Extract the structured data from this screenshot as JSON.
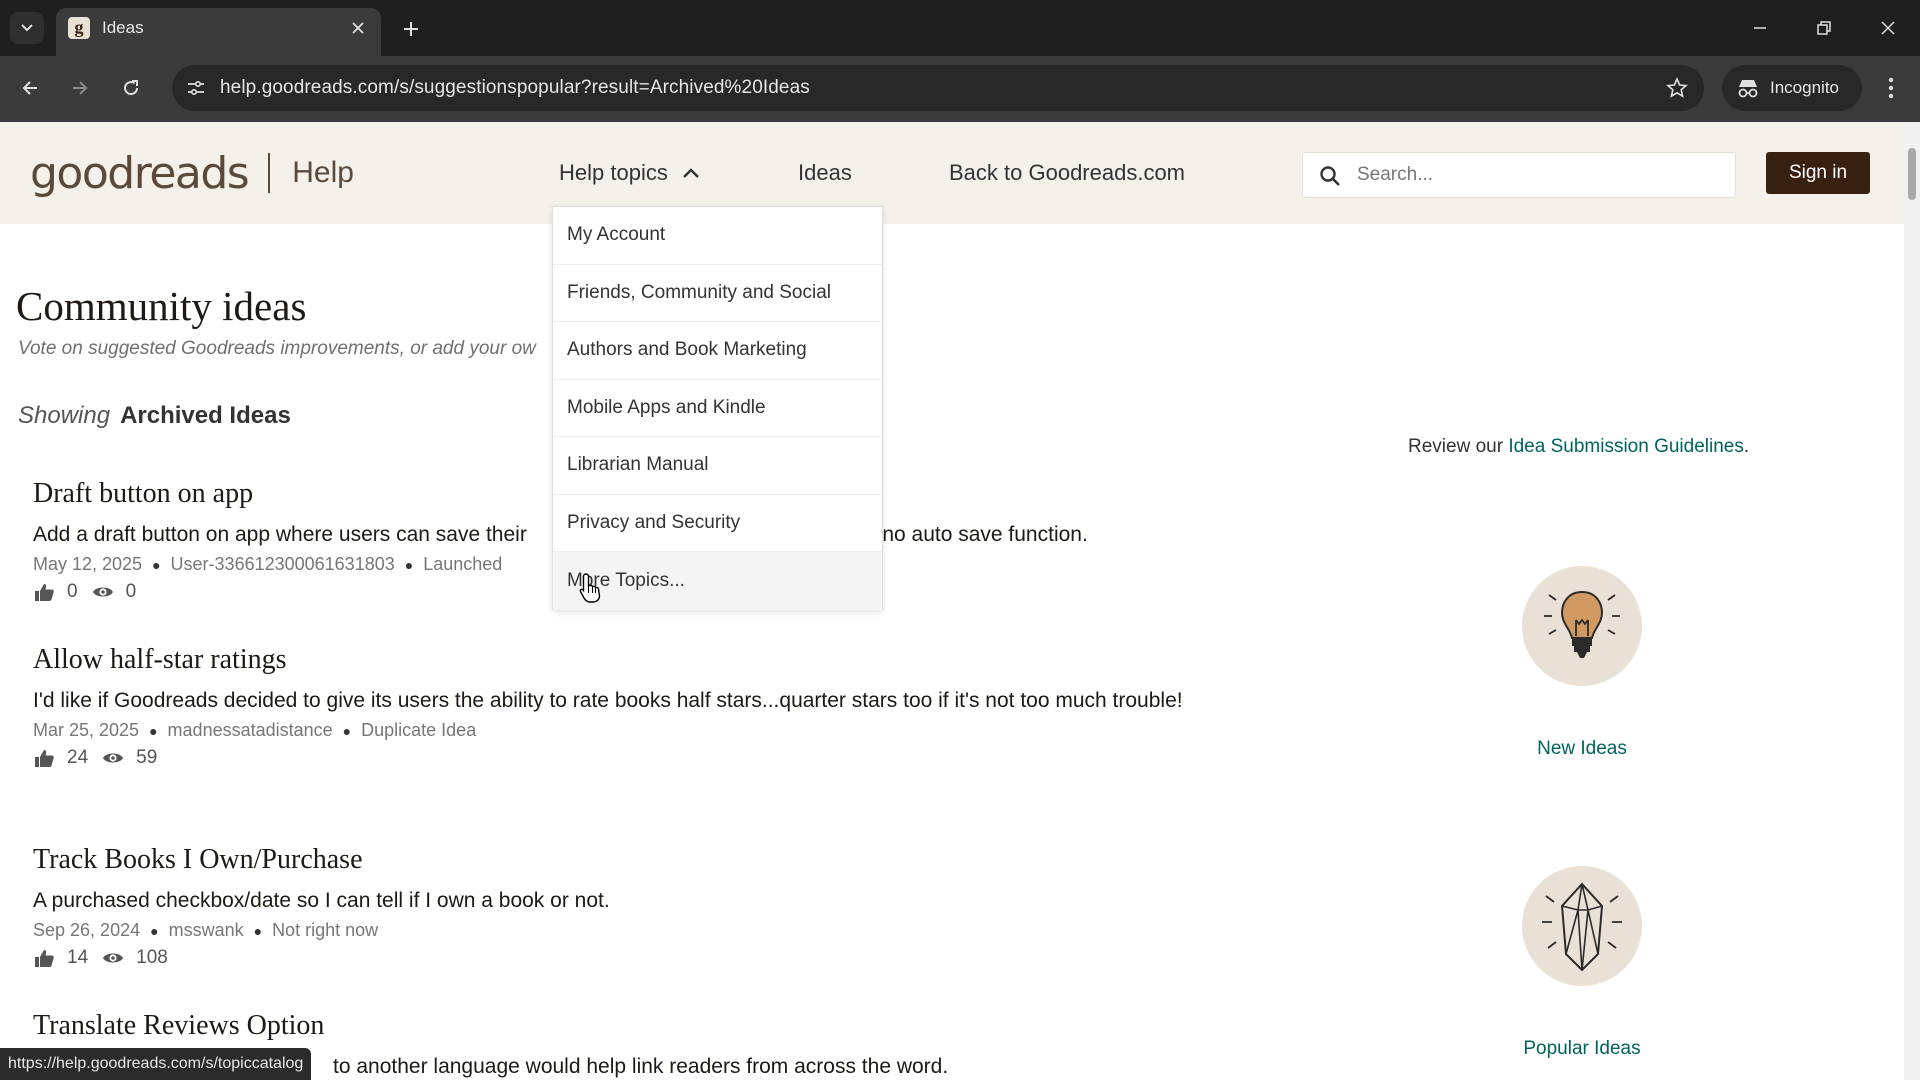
{
  "browser": {
    "tab_title": "Ideas",
    "favicon_letter": "g",
    "url": "help.goodreads.com/s/suggestionspopular?result=Archived%20Ideas",
    "incognito_label": "Incognito",
    "icons": [
      "tab-search-icon",
      "close-icon",
      "new-tab-icon",
      "minimize-icon",
      "restore-icon",
      "window-close-icon",
      "back-icon",
      "forward-icon",
      "reload-icon",
      "site-info-icon",
      "star-icon",
      "incognito-icon",
      "more-menu-icon"
    ]
  },
  "header": {
    "logo_word": "goodreads",
    "logo_help": "Help",
    "nav": {
      "help_topics": "Help topics",
      "ideas": "Ideas",
      "back": "Back to Goodreads.com"
    },
    "search_placeholder": "Search...",
    "sign_in": "Sign in"
  },
  "dropdown": {
    "items": [
      "My Account",
      "Friends, Community and Social",
      "Authors and Book Marketing",
      "Mobile Apps and Kindle",
      "Librarian Manual",
      "Privacy and Security",
      "More Topics..."
    ]
  },
  "main": {
    "title": "Community ideas",
    "subtitle": "Vote on suggested Goodreads improvements, or add your ow",
    "showing_label": "Showing",
    "showing_value": "Archived Ideas",
    "ideas": [
      {
        "title": "Draft button on app",
        "body_start": "Add a draft button on app where users can save their",
        "body_end": "re is no auto save function.",
        "date": "May 12, 2025",
        "author": "User-336612300061631803",
        "status": "Launched",
        "likes": "0",
        "views": "0"
      },
      {
        "title": "Allow half-star ratings",
        "body": "I'd like if Goodreads decided to give its users the ability to rate books half stars...quarter stars too if it's not too much trouble!",
        "date": "Mar 25, 2025",
        "author": "madnessatadistance",
        "status": "Duplicate Idea",
        "likes": "24",
        "views": "59"
      },
      {
        "title": "Track Books I Own/Purchase",
        "body": "A purchased checkbox/date so I can tell if I own a book or not.",
        "date": "Sep 26, 2024",
        "author": "msswank",
        "status": "Not right now",
        "likes": "14",
        "views": "108"
      },
      {
        "title": "Translate Reviews Option",
        "body": "to another language would help link readers from across the word."
      }
    ]
  },
  "sidebar": {
    "guidelines_prefix": "Review our ",
    "guidelines_link": "Idea Submission Guidelines",
    "guidelines_suffix": ".",
    "new_ideas": "New Ideas",
    "popular_ideas": "Popular Ideas"
  },
  "status_bar": "https://help.goodreads.com/s/topiccatalog",
  "colors": {
    "header_bg": "#f4f1ea",
    "brand_brown": "#382110",
    "link_teal": "#00635d"
  }
}
